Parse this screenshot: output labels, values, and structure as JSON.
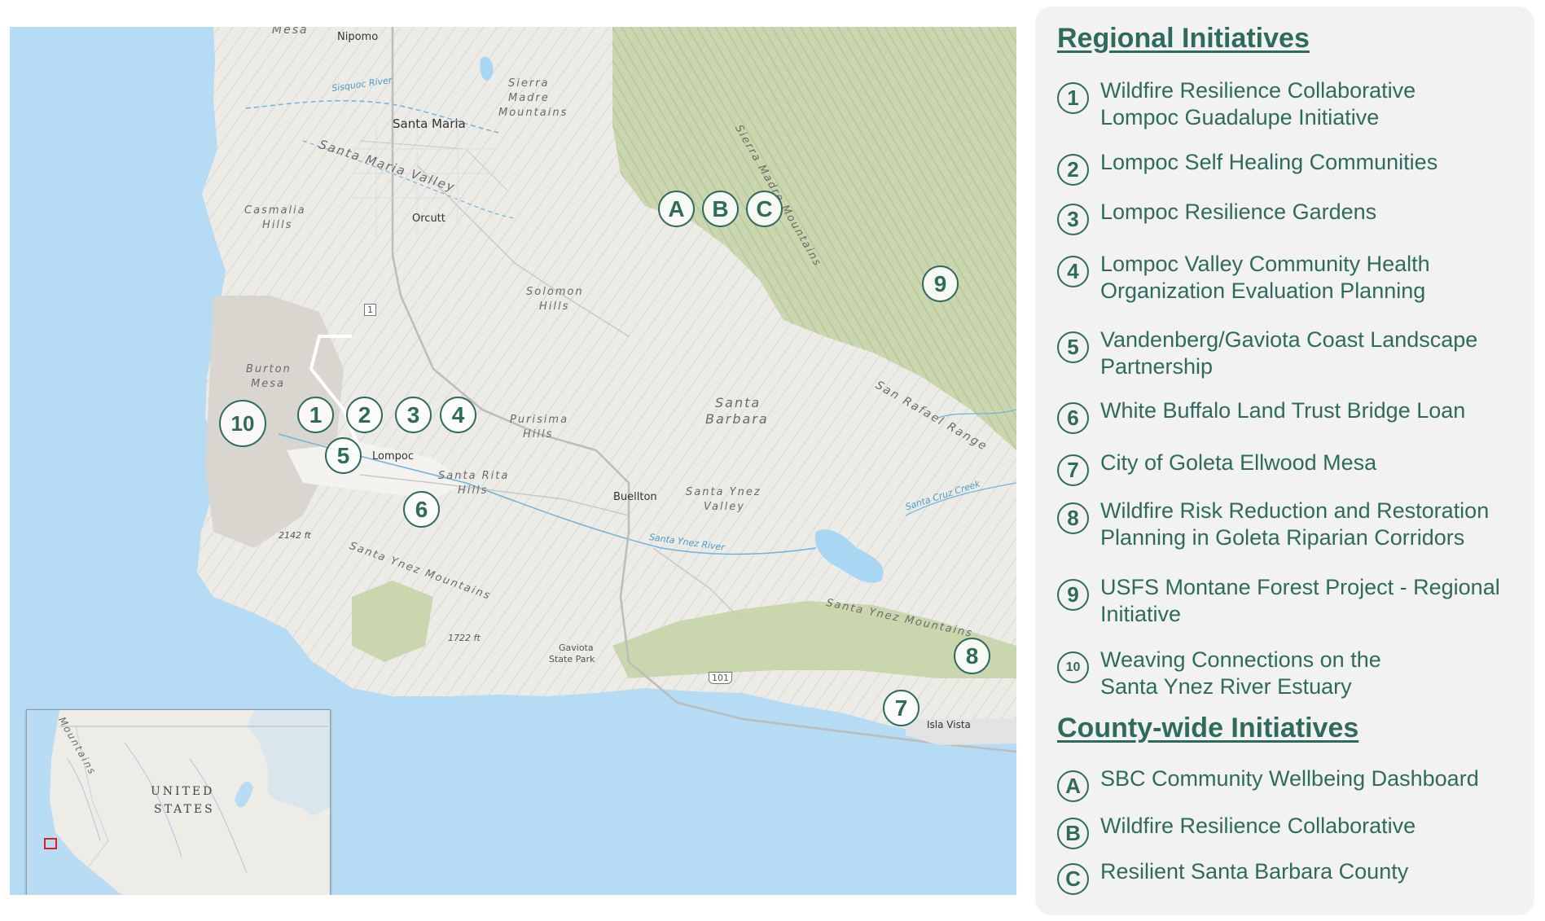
{
  "map": {
    "place_labels": {
      "mesa": "Mesa",
      "nipomo": "Nipomo",
      "sisquoc_river": "Sisquoc River",
      "sierra_madre_mountains_1": "Sierra",
      "sierra_madre_mountains_2": "Madre",
      "sierra_madre_mountains_3": "Mountains",
      "sierra_madre_diag": "Sierra Madre Mountains",
      "santa_maria": "Santa Maria",
      "santa_maria_valley": "Santa Maria Valley",
      "casmalia_1": "Casmalia",
      "casmalia_2": "Hills",
      "orcutt": "Orcutt",
      "solomon_1": "Solomon",
      "solomon_2": "Hills",
      "route_1": "1",
      "burton_1": "Burton",
      "burton_2": "Mesa",
      "purisima_1": "Purisima",
      "purisima_2": "Hills",
      "santa_barbara_1": "Santa",
      "santa_barbara_2": "Barbara",
      "san_rafael_range": "San Rafael Range",
      "lompoc": "Lompoc",
      "santa_rita_1": "Santa Rita",
      "santa_rita_2": "Hills",
      "buellton": "Buellton",
      "santa_ynez_valley_1": "Santa Ynez",
      "santa_ynez_valley_2": "Valley",
      "santa_cruz_creek": "Santa Cruz Creek",
      "elev_2142": "2142 ft",
      "santa_ynez_river": "Santa Ynez River",
      "santa_ynez_mountains_w": "Santa Ynez Mountains",
      "santa_ynez_mountains_e": "Santa Ynez Mountains",
      "elev_1722": "1722 ft",
      "gaviota_1": "Gaviota",
      "gaviota_2": "State Park",
      "route_101": "101",
      "isla_vista": "Isla Vista"
    },
    "markers": [
      "1",
      "2",
      "3",
      "4",
      "5",
      "6",
      "7",
      "8",
      "9",
      "10",
      "A",
      "B",
      "C"
    ]
  },
  "inset": {
    "mountains": "Mountains",
    "united": "UNITED",
    "states": "STATES",
    "highlight_color": "#e02020"
  },
  "legend": {
    "regional_heading": "Regional Initiatives",
    "regional": [
      {
        "marker": "1",
        "label": "Wildfire Resilience Collaborative Lompoc Guadalupe Initiative"
      },
      {
        "marker": "2",
        "label": "Lompoc Self Healing Communities"
      },
      {
        "marker": "3",
        "label": "Lompoc Resilience Gardens"
      },
      {
        "marker": "4",
        "label": "Lompoc Valley Community Health Organization Evaluation Planning"
      },
      {
        "marker": "5",
        "label": "Vandenberg/Gaviota Coast Landscape Partnership"
      },
      {
        "marker": "6",
        "label": "White Buffalo Land Trust Bridge Loan"
      },
      {
        "marker": "7",
        "label": "City of Goleta Ellwood Mesa"
      },
      {
        "marker": "8",
        "label": "Wildfire Risk Reduction and Restoration Planning in Goleta Riparian Corridors"
      },
      {
        "marker": "9",
        "label": "USFS Montane Forest Project - Regional Initiative"
      },
      {
        "marker": "10",
        "label": "Weaving Connections on the Santa Ynez River Estuary"
      }
    ],
    "county_heading": "County-wide Initiatives",
    "county": [
      {
        "marker": "A",
        "label": "SBC Community Wellbeing Dashboard"
      },
      {
        "marker": "B",
        "label": "Wildfire Resilience Collaborative"
      },
      {
        "marker": "C",
        "label": "Resilient Santa Barbara County"
      }
    ],
    "accent_color": "#2f6b5d"
  }
}
